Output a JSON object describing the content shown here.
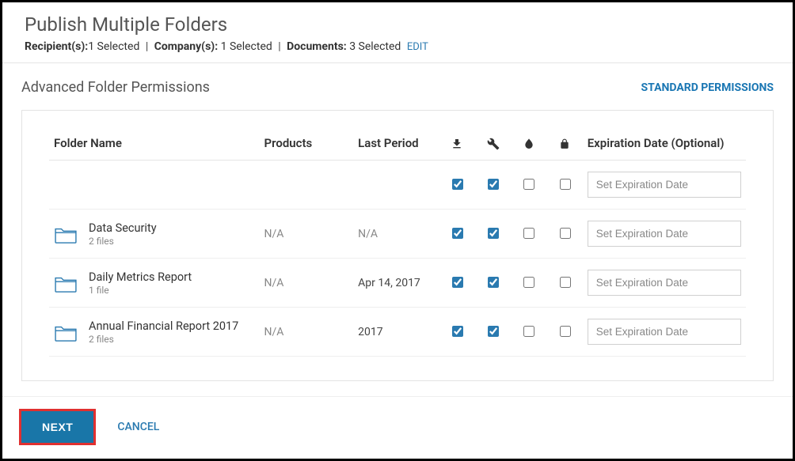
{
  "header": {
    "title": "Publish Multiple Folders",
    "recipients_label": "Recipient(s):",
    "recipients_value": "1 Selected",
    "companies_label": "Company(s):",
    "companies_value": "1 Selected",
    "documents_label": "Documents:",
    "documents_value": "3 Selected",
    "edit_label": "EDIT"
  },
  "section": {
    "title": "Advanced Folder Permissions",
    "standard_link": "STANDARD PERMISSIONS"
  },
  "columns": {
    "folder": "Folder Name",
    "products": "Products",
    "last_period": "Last Period",
    "expiration": "Expiration Date (Optional)"
  },
  "expiration_placeholder": "Set Expiration Date",
  "rows": [
    {
      "name": "",
      "files": "",
      "products": "",
      "last_period": "",
      "c1": true,
      "c2": true,
      "c3": false,
      "c4": false
    },
    {
      "name": "Data Security",
      "files": "2 files",
      "products": "N/A",
      "last_period": "N/A",
      "c1": true,
      "c2": true,
      "c3": false,
      "c4": false
    },
    {
      "name": "Daily Metrics Report",
      "files": "1 file",
      "products": "N/A",
      "last_period": "Apr 14, 2017",
      "c1": true,
      "c2": true,
      "c3": false,
      "c4": false
    },
    {
      "name": "Annual Financial Report 2017",
      "files": "2 files",
      "products": "N/A",
      "last_period": "2017",
      "c1": true,
      "c2": true,
      "c3": false,
      "c4": false
    }
  ],
  "footer": {
    "next": "NEXT",
    "cancel": "CANCEL"
  }
}
